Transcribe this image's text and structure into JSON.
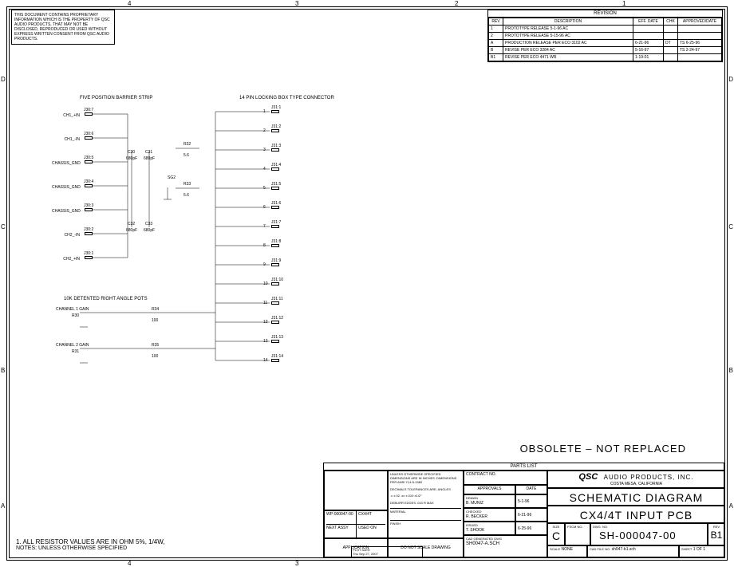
{
  "proprietary_text": "THIS DOCUMENT CONTAINS PROPRIETARY INFORMATION WHICH IS THE PROPERTY OF QSC AUDIO PRODUCTS, THAT MAY NOT BE DISCLOSED, REPRODUCED OR USED WITHOUT EXPRESS WRITTEN CONSENT FROM QSC AUDIO PRODUCTS.",
  "zones": {
    "top": [
      "4",
      "3",
      "2",
      "1"
    ],
    "side": [
      "D",
      "C",
      "B",
      "A"
    ]
  },
  "revision": {
    "title": "REVISION",
    "headers": [
      "REV",
      "DESCRIPTION",
      "EFF. DATE",
      "CHK",
      "APPROVED/DATE"
    ],
    "rows": [
      {
        "rev": "1",
        "desc": "PROTOTYPE RELEASE 5-1-96 AC",
        "eff": "",
        "chk": "",
        "appr": ""
      },
      {
        "rev": "2",
        "desc": "PROTOTYPE RELEASE 5-15-96 AC",
        "eff": "",
        "chk": "",
        "appr": ""
      },
      {
        "rev": "A",
        "desc": "PRODUCTION RELEASE PER ECO 3102 AC",
        "eff": "6-21-96",
        "chk": "DT",
        "appr": "TS  6-25-96"
      },
      {
        "rev": "B",
        "desc": "REVISE PER ECO 3284 AC",
        "eff": "5-16-97",
        "chk": "",
        "appr": "TS 2-24-97"
      },
      {
        "rev": "B1",
        "desc": "REVISE PER ECO 4471 WR",
        "eff": "1-19-01",
        "chk": "",
        "appr": ""
      }
    ]
  },
  "schematic": {
    "header_left": "FIVE POSITION BARRIER STRIP",
    "header_right": "14 PIN LOCKING BOX TYPE CONNECTOR",
    "pots_header": "10K DETENTED RIGHT ANGLE POTS",
    "ch1_gain": "CHANNEL 1 GAIN",
    "ch2_gain": "CHANNEL 2 GAIN",
    "j30": [
      {
        "ref": "J30:7",
        "sig": "CH1_+IN",
        "pin": "7"
      },
      {
        "ref": "J30:6",
        "sig": "CH1_-IN",
        "pin": "6"
      },
      {
        "ref": "J30:5",
        "sig": "CHASSIS_GND",
        "pin": "5"
      },
      {
        "ref": "J30:4",
        "sig": "CHASSIS_GND",
        "pin": "4"
      },
      {
        "ref": "J30:3",
        "sig": "CHASSIS_GND",
        "pin": "3"
      },
      {
        "ref": "J30:2",
        "sig": "CH2_-IN",
        "pin": "2"
      },
      {
        "ref": "J30:1",
        "sig": "CH2_+IN",
        "pin": "1"
      }
    ],
    "j31": [
      "J31:1",
      "J31:2",
      "J31:3",
      "J31:4",
      "J31:5",
      "J31:6",
      "J31:7",
      "J31:8",
      "J31:9",
      "J31:10",
      "J31:11",
      "J31:12",
      "J31:13",
      "J31:14"
    ],
    "components": {
      "C30": {
        "val": "680pF"
      },
      "C31": {
        "val": "680pF"
      },
      "C32": {
        "val": "680pF"
      },
      "C33": {
        "val": "680pF"
      },
      "R32": {
        "val": "5.6"
      },
      "R33": {
        "val": "5.6"
      },
      "R34": {
        "val": "100"
      },
      "R35": {
        "val": "100"
      },
      "R30": {
        "val": ""
      },
      "R31": {
        "val": ""
      },
      "SG2": {
        "val": ""
      }
    }
  },
  "obsolete": "OBSOLETE – NOT REPLACED",
  "notes": {
    "line1": "1. ALL RESISTOR VALUES ARE IN OHM 5%, 1/4W,",
    "line2": "NOTES: UNLESS OTHERWISE SPECIFIED"
  },
  "parts_list_label": "PARTS LIST",
  "title_block": {
    "tolerances": "UNLESS OTHERWISE SPECIFIED DIMENSIONS ARE IN INCHES. DIMENSIONS PER ANSI Y14.5-1982",
    "tol_label": "DECIMALS          TOLERANCES ARE:          ANGLES",
    "tol_vals": ".x   ±.02      .xx   ±.010    ±1/2°",
    "edges": "DEBURR EDGES .010 R MAX",
    "contract_label": "CONTRACT NO.",
    "approvals_hdr": "APPROVALS",
    "date_hdr": "DATE",
    "drawn_lbl": "DRAWN",
    "drawn": "B. MUNIZ",
    "drawn_date": "5-1-96",
    "checked_lbl": "CHECKED",
    "checked": "R. BECKER",
    "checked_date": "6-21-96",
    "issued_lbl": "ISSUED",
    "issued": "T. SHOOK",
    "issued_date": "6-25-96",
    "material_lbl": "MATERIAL",
    "finish_lbl": "FINISH",
    "company": "AUDIO PRODUCTS, INC.",
    "company_loc": "COSTA MESA, CALIFORNIA",
    "logo": "QSC",
    "title1": "SCHEMATIC DIAGRAM",
    "title2": "CX4/4T INPUT PCB",
    "size_lbl": "SIZE",
    "size": "C",
    "fscm_lbl": "FSCM NO.",
    "dwg_lbl": "DWG. NO.",
    "dwg": "SH-000047-00",
    "rev_lbl": "REV",
    "rev": "B1",
    "scale_lbl": "SCALE",
    "scale": "NONE",
    "cad_lbl": "CAD FILE NO.",
    "cad": "sh047-b1.sch",
    "sheet_lbl": "SHEET",
    "sheet": "1  OF  1",
    "do_not_scale": "DO NOT SCALE DRAWING",
    "cad_gen": "CAD GENERATED DWG",
    "cad_gen_file": "SH0047-A.SCH",
    "plot_lbl": "PLOT DATE",
    "plot": "Thu Sep 27, 2007",
    "next_assy_lbl": "NEXT ASSY",
    "used_on_lbl": "USED ON",
    "application_lbl": "APPLICATION",
    "wp": "WP-000047-00",
    "model": "CX4/4T"
  }
}
